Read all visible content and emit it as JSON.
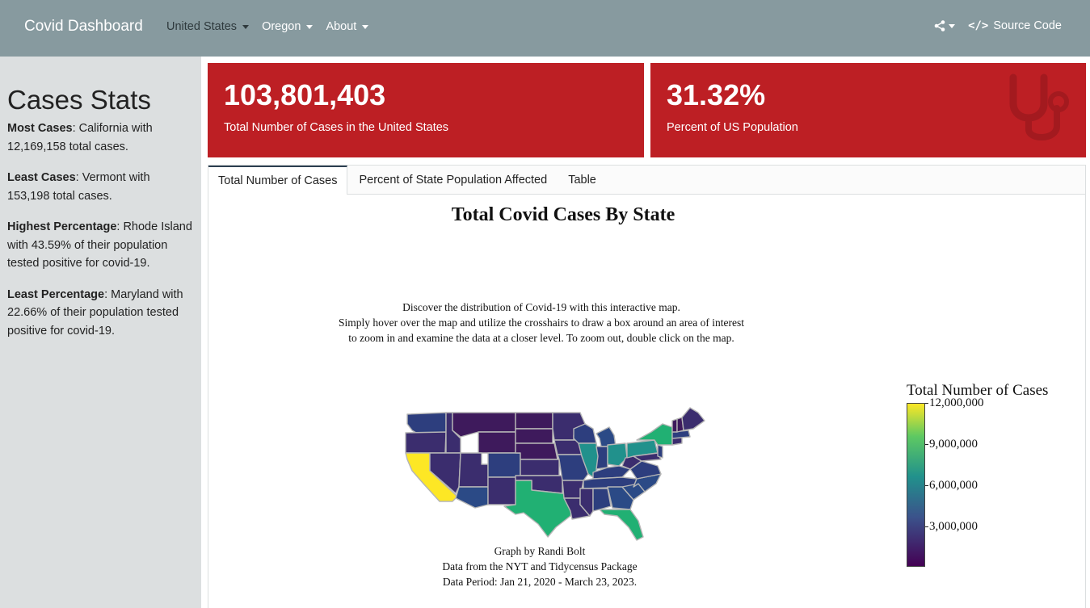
{
  "navbar": {
    "brand": "Covid Dashboard",
    "menus": [
      {
        "label": "United States"
      },
      {
        "label": "Oregon"
      },
      {
        "label": "About"
      }
    ],
    "source_code_label": "Source Code"
  },
  "sidebar": {
    "title": "Cases Stats",
    "stats": [
      {
        "key": "Most Cases",
        "text": ": California with 12,169,158 total cases."
      },
      {
        "key": "Least Cases",
        "text": ": Vermont with 153,198 total cases."
      },
      {
        "key": "Highest Percentage",
        "text": ": Rhode Island with 43.59% of their population tested positive for covid-19."
      },
      {
        "key": "Least Percentage",
        "text": ": Maryland with 22.66% of their population tested positive for covid-19."
      }
    ]
  },
  "value_boxes": [
    {
      "value": "103,801,403",
      "label": "Total Number of Cases in the United States"
    },
    {
      "value": "31.32%",
      "label": "Percent of US Population"
    }
  ],
  "tabs": [
    {
      "label": "Total Number of Cases",
      "active": true
    },
    {
      "label": "Percent of State Population Affected",
      "active": false
    },
    {
      "label": "Table",
      "active": false
    }
  ],
  "map": {
    "title": "Total Covid Cases By State",
    "description": [
      "Discover the distribution of Covid-19 with this interactive map.",
      "Simply hover over the map and utilize the crosshairs to draw a box around an area of interest",
      "to zoom in and examine the data at a closer level. To zoom out, double click on the map."
    ],
    "credits": [
      "Graph by Randi Bolt",
      "Data from the NYT and Tidycensus Package",
      "Data Period: Jan 21, 2020 - March 23, 2023."
    ],
    "legend": {
      "title": "Total Number of Cases",
      "ticks": [
        "12,000,000",
        "9,000,000",
        "6,000,000",
        "3,000,000"
      ],
      "colors": [
        "#fde725",
        "#5ec962",
        "#21918c",
        "#3b528b",
        "#440154"
      ]
    }
  },
  "colors": {
    "navbar": "#879a9f",
    "sidebar": "#dcdfe0",
    "value_box": "#bd1f24"
  }
}
